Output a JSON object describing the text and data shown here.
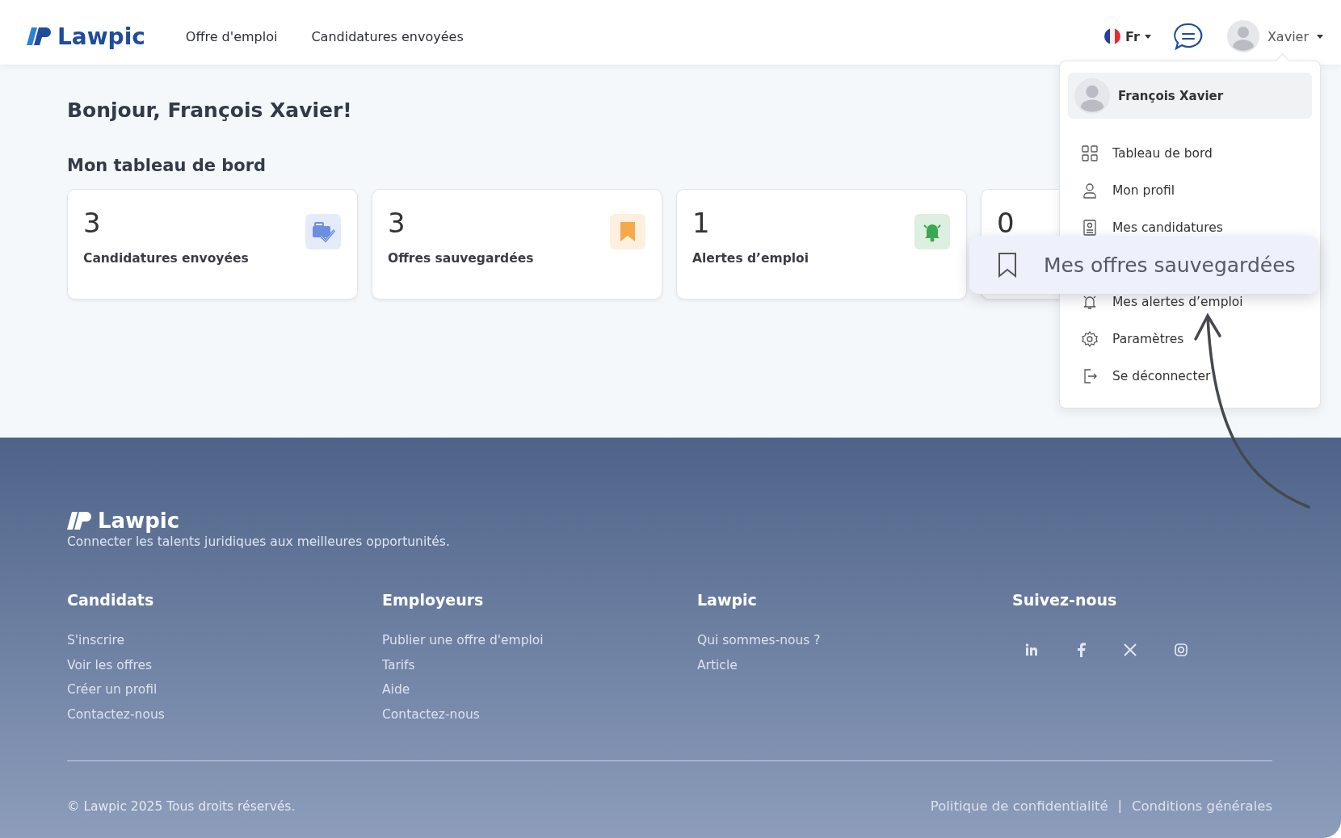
{
  "header": {
    "logo": "Lawpic",
    "nav": [
      {
        "label": "Offre d'emploi"
      },
      {
        "label": "Candidatures envoyées"
      }
    ],
    "language": "Fr",
    "user": "Xavier"
  },
  "user_menu": {
    "name": "François Xavier",
    "items": [
      {
        "label": "Tableau de bord",
        "highlighted": false
      },
      {
        "label": "Mon profil",
        "highlighted": false
      },
      {
        "label": "Mes candidatures",
        "highlighted": false
      },
      {
        "label": "Mes offres sauvegardées",
        "highlighted": true
      },
      {
        "label": "Mes alertes d’emploi",
        "highlighted": false
      },
      {
        "label": "Paramètres",
        "highlighted": false
      },
      {
        "label": "Se déconnecter",
        "highlighted": false
      }
    ]
  },
  "greeting": "Bonjour, François Xavier!",
  "dashboard": {
    "title": "Mon tableau de bord",
    "cards": [
      {
        "value": "3",
        "label": "Candidatures envoyées",
        "color": "#6c8fe0"
      },
      {
        "value": "3",
        "label": "Offres sauvegardées",
        "color": "#f5a94a"
      },
      {
        "value": "1",
        "label": "Alertes d’emploi",
        "color": "#3aa852"
      },
      {
        "value": "0"
      }
    ]
  },
  "footer": {
    "logo": "Lawpic",
    "tagline": "Connecter les talents juridiques aux meilleures opportunités.",
    "columns": [
      {
        "title": "Candidats",
        "links": [
          "S'inscrire",
          "Voir les offres",
          "Créer un profil",
          "Contactez-nous"
        ]
      },
      {
        "title": "Employeurs",
        "links": [
          "Publier une offre d'emploi",
          "Tarifs",
          "Aide",
          "Contactez-nous"
        ]
      },
      {
        "title": "Lawpic",
        "links": [
          "Qui sommes-nous ?",
          "Article"
        ]
      },
      {
        "title": "Suivez-nous",
        "kind": "social"
      }
    ],
    "copyright": "© Lawpic 2025 Tous droits réservés.",
    "legal": [
      "Politique de confidentialité",
      "Conditions générales"
    ],
    "separator": "|"
  }
}
